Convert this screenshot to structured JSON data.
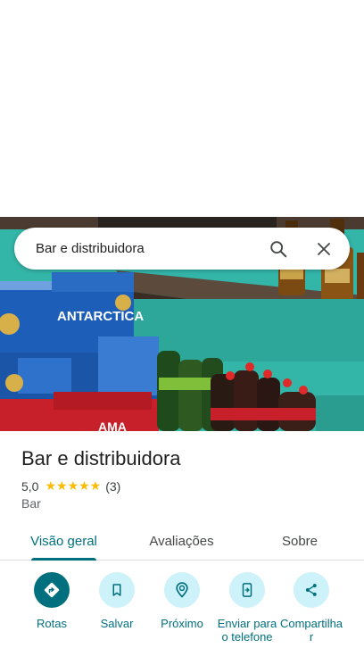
{
  "search": {
    "query": "Bar e distribuidora"
  },
  "icons": {
    "search": "search-icon",
    "close": "close-icon"
  },
  "place": {
    "name": "Bar e distribuidora",
    "rating": "5,0",
    "stars": "★★★★★",
    "review_count": "(3)",
    "category": "Bar"
  },
  "photo": {
    "brand_text": "ANTARCTICA",
    "pack_text": "AMA"
  },
  "tabs": [
    {
      "label": "Visão geral",
      "active": true
    },
    {
      "label": "Avaliações",
      "active": false
    },
    {
      "label": "Sobre",
      "active": false
    }
  ],
  "actions": [
    {
      "label": "Rotas",
      "icon": "directions-icon"
    },
    {
      "label": "Salvar",
      "icon": "bookmark-icon"
    },
    {
      "label": "Próximo",
      "icon": "nearby-icon"
    },
    {
      "label": "Enviar para o telefone",
      "icon": "send-to-phone-icon"
    },
    {
      "label": "Compartilhar",
      "icon": "share-icon"
    }
  ],
  "colors": {
    "accent": "#00707f",
    "accent_light": "#cdf2f9",
    "star": "#fbbc04"
  }
}
